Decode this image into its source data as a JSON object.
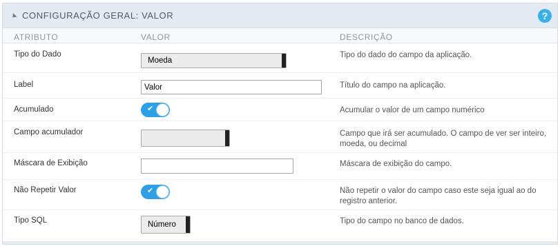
{
  "panel": {
    "title": "CONFIGURAÇÃO GERAL: VALOR",
    "help_label": "?"
  },
  "columns": {
    "attribute": "ATRIBUTO",
    "value": "VALOR",
    "description": "DESCRIÇÃO"
  },
  "rows": [
    {
      "attribute": "Tipo do Dado",
      "control": "select",
      "value": "Moeda",
      "description": "Tipo do dado do campo da aplicação."
    },
    {
      "attribute": "Label",
      "control": "input",
      "value": "Valor",
      "description": "Título do campo na aplicação."
    },
    {
      "attribute": "Acumulado",
      "control": "toggle",
      "value": "on",
      "description": "Acumular o valor de um campo numérico"
    },
    {
      "attribute": "Campo acumulador",
      "control": "select",
      "value": "",
      "description": "Campo que irá ser acumulado. O campo de ver ser inteiro, moeda, ou decimal"
    },
    {
      "attribute": "Máscara de Exibição",
      "control": "input",
      "value": "",
      "description": "Máscara de exibição do campo."
    },
    {
      "attribute": "Não Repetir Valor",
      "control": "toggle",
      "value": "on",
      "description": "Não repetir o valor do campo caso este seja igual ao do registro anterior."
    },
    {
      "attribute": "Tipo SQL",
      "control": "select",
      "value": "Número",
      "description": "Tipo do campo no banco de dados."
    }
  ],
  "icons": {
    "toggle_check": "✔"
  },
  "colors": {
    "accent": "#2da0e8",
    "header_bg": "#e4eaf1",
    "help_bg": "#3ab0ea"
  }
}
